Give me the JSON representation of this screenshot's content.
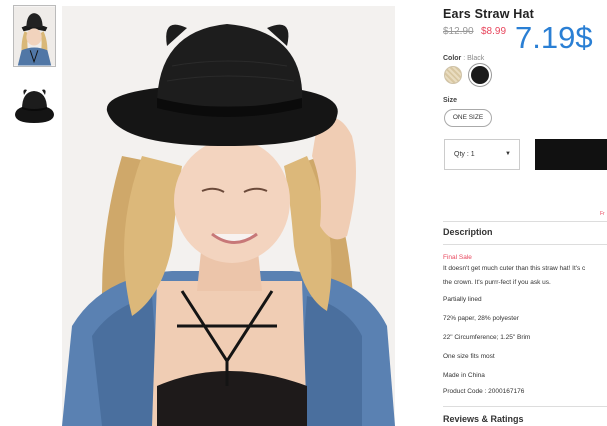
{
  "product": {
    "title": "Ears Straw Hat",
    "original_price": "$12.90",
    "sale_price": "$8.99",
    "price_overlay": "7.19$"
  },
  "color": {
    "label": "Color",
    "separator": ":",
    "selected": "Black",
    "swatches": [
      {
        "name": "natural",
        "hex": "#e6d8b8"
      },
      {
        "name": "black",
        "hex": "#1b1b1b"
      }
    ]
  },
  "size": {
    "label": "Size",
    "option": "ONE SIZE"
  },
  "quantity": {
    "label": "Qty : 1",
    "caret": "▼"
  },
  "misc": {
    "fr_text": "Fr"
  },
  "description": {
    "title": "Description",
    "final_sale": "Final Sale",
    "lines": [
      "It doesn't get much cuter than this straw hat! It's c",
      "the crown. It's purrr-fect if you ask us.",
      "Partially lined",
      "72% paper, 28% polyester",
      "22\" Circumference; 1.25\" Brim",
      "One size fits most",
      "Made in China",
      "Product Code : 2000167176"
    ]
  },
  "reviews": {
    "title": "Reviews & Ratings"
  }
}
